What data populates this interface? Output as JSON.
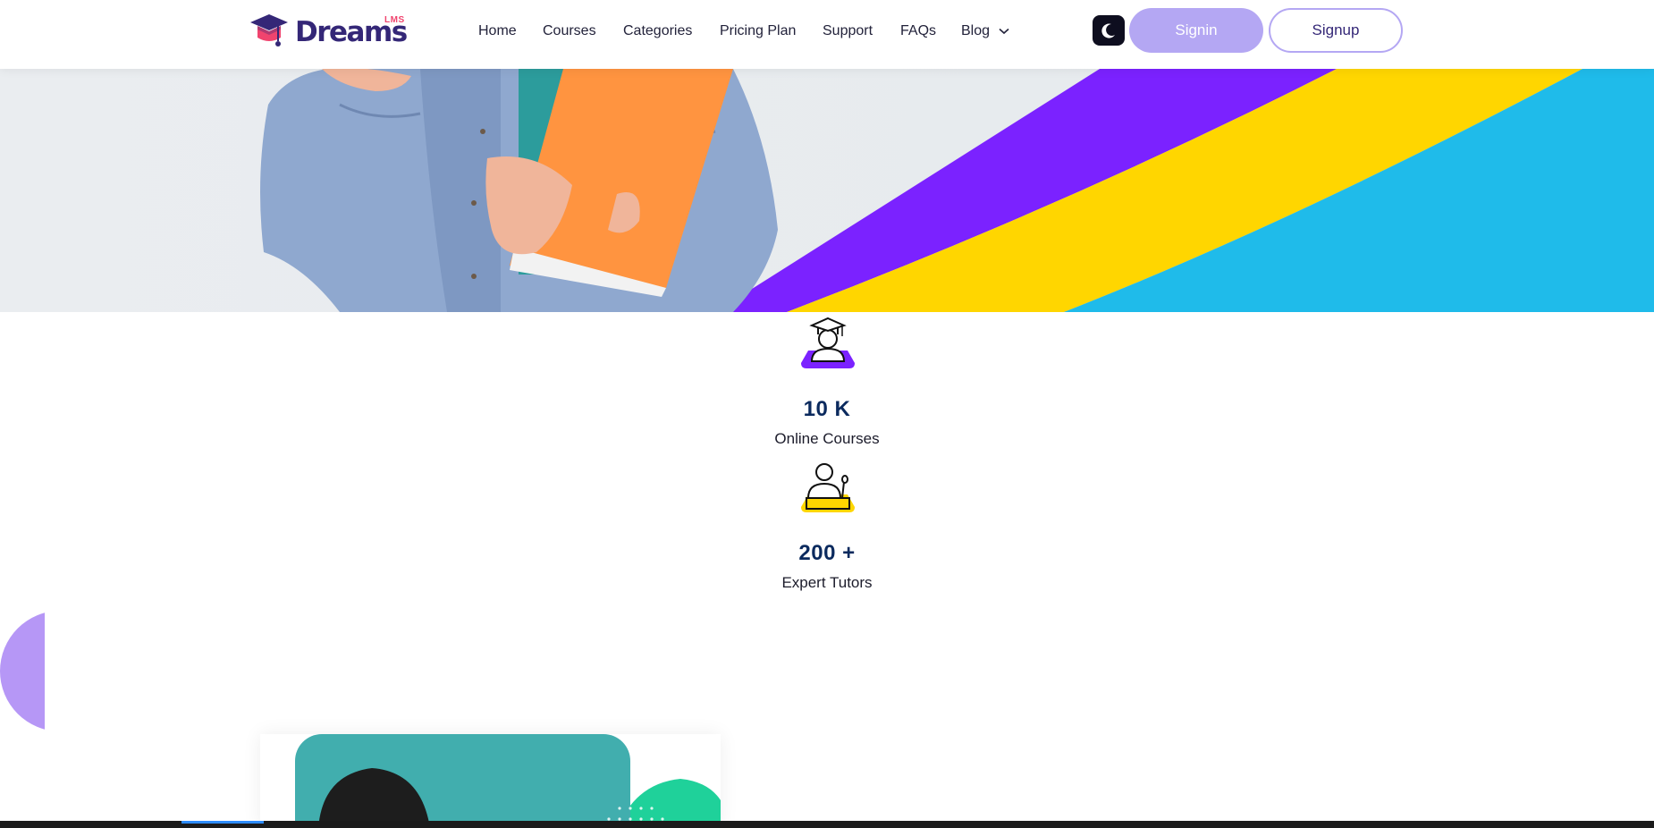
{
  "brand": {
    "name": "Dreams",
    "suffix": "LMS"
  },
  "nav": {
    "items": [
      {
        "label": "Home"
      },
      {
        "label": "Courses"
      },
      {
        "label": "Categories"
      },
      {
        "label": "Pricing Plan"
      },
      {
        "label": "Support"
      },
      {
        "label": "FAQs"
      },
      {
        "label": "Blog"
      }
    ]
  },
  "header": {
    "theme_icon": "moon-icon",
    "signin_label": "Signin",
    "signup_label": "Signup"
  },
  "stats": [
    {
      "value": "10 K",
      "label": "Online Courses",
      "icon": "graduate-icon",
      "color": "#7b22ff"
    },
    {
      "value": "200 +",
      "label": "Expert Tutors",
      "icon": "tutor-icon",
      "color": "#ffd600"
    }
  ],
  "colors": {
    "brand_navy": "#342777",
    "accent_purple": "#7b22ff",
    "accent_yellow": "#ffd600",
    "accent_cyan": "#1fbbea",
    "signin_bg": "#b4a7f3",
    "logo_pink": "#f0446e"
  }
}
